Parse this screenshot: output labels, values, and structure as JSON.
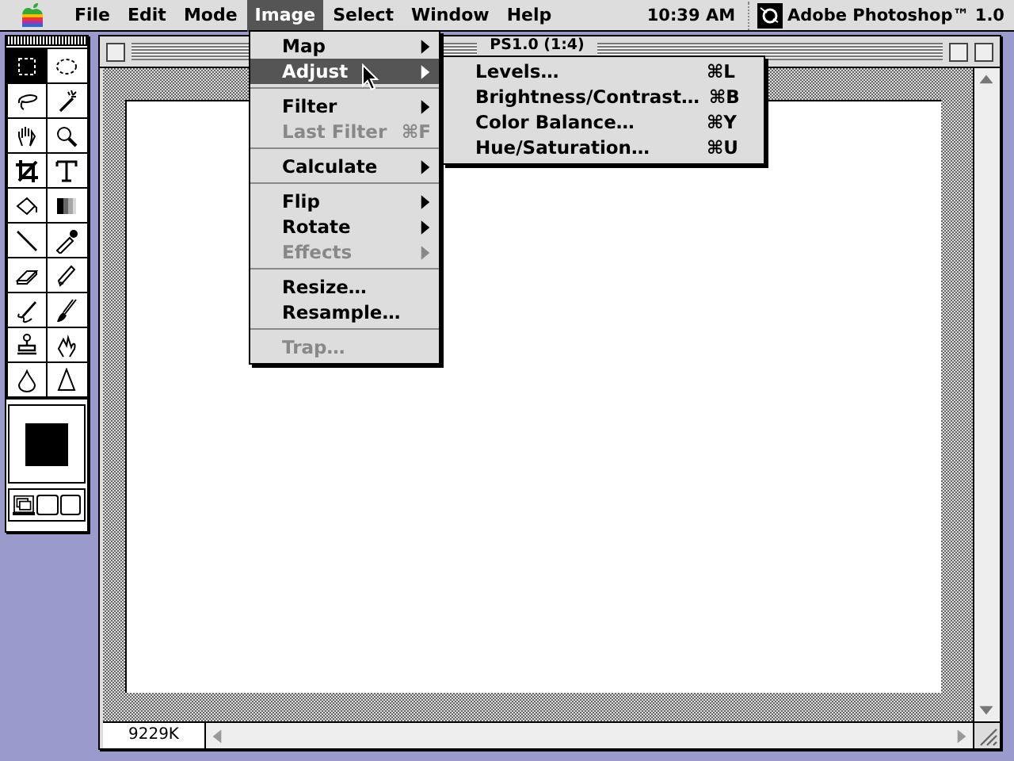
{
  "menu_bar": {
    "items": [
      {
        "label": "File",
        "selected": false
      },
      {
        "label": "Edit",
        "selected": false
      },
      {
        "label": "Mode",
        "selected": false
      },
      {
        "label": "Image",
        "selected": true
      },
      {
        "label": "Select",
        "selected": false
      },
      {
        "label": "Window",
        "selected": false
      },
      {
        "label": "Help",
        "selected": false
      }
    ],
    "clock": "10:39 AM",
    "app": "Adobe Photoshop™ 1.0"
  },
  "toolbox": {
    "tools": [
      {
        "selected": true
      },
      {
        "selected": false
      },
      {
        "selected": false
      },
      {
        "selected": false
      },
      {
        "selected": false
      },
      {
        "selected": false
      },
      {
        "selected": false
      },
      {
        "selected": false
      },
      {
        "selected": false
      },
      {
        "selected": false
      },
      {
        "selected": false
      },
      {
        "selected": false
      },
      {
        "selected": false
      },
      {
        "selected": false
      },
      {
        "selected": false
      },
      {
        "selected": false
      },
      {
        "selected": false
      },
      {
        "selected": false
      },
      {
        "selected": false
      },
      {
        "selected": false
      }
    ],
    "modes": [
      {
        "selected": true
      },
      {
        "selected": false
      },
      {
        "selected": false
      }
    ]
  },
  "document": {
    "title": "PS1.0 (1:4)",
    "size": "9229K"
  },
  "menu": {
    "items": [
      {
        "kind": "item",
        "label": "Map",
        "submenu": true,
        "disabled": false,
        "selected": false
      },
      {
        "kind": "item",
        "label": "Adjust",
        "submenu": true,
        "disabled": false,
        "selected": true
      },
      {
        "kind": "separator"
      },
      {
        "kind": "item",
        "label": "Filter",
        "submenu": true,
        "disabled": false,
        "selected": false
      },
      {
        "kind": "item",
        "label": "Last Filter",
        "shortcut": "⌘F",
        "submenu": false,
        "disabled": true,
        "selected": false
      },
      {
        "kind": "separator"
      },
      {
        "kind": "item",
        "label": "Calculate",
        "submenu": true,
        "disabled": false,
        "selected": false
      },
      {
        "kind": "separator"
      },
      {
        "kind": "item",
        "label": "Flip",
        "submenu": true,
        "disabled": false,
        "selected": false
      },
      {
        "kind": "item",
        "label": "Rotate",
        "submenu": true,
        "disabled": false,
        "selected": false
      },
      {
        "kind": "item",
        "label": "Effects",
        "submenu": true,
        "disabled": true,
        "selected": false
      },
      {
        "kind": "separator"
      },
      {
        "kind": "item",
        "label": "Resize…",
        "submenu": false,
        "disabled": false,
        "selected": false
      },
      {
        "kind": "item",
        "label": "Resample…",
        "submenu": false,
        "disabled": false,
        "selected": false
      },
      {
        "kind": "separator"
      },
      {
        "kind": "item",
        "label": "Trap…",
        "submenu": false,
        "disabled": true,
        "selected": false
      }
    ]
  },
  "submenu": {
    "items": [
      {
        "label": "Levels…",
        "shortcut": "⌘L"
      },
      {
        "label": "Brightness/Contrast…",
        "shortcut": "⌘B"
      },
      {
        "label": "Color Balance…",
        "shortcut": "⌘Y"
      },
      {
        "label": "Hue/Saturation…",
        "shortcut": "⌘U"
      }
    ]
  }
}
